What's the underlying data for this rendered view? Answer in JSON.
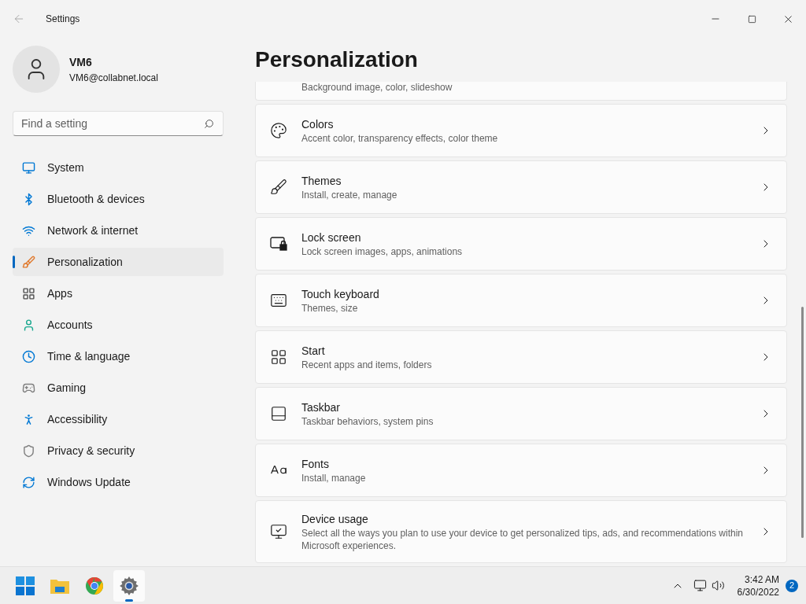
{
  "window": {
    "title": "Settings"
  },
  "profile": {
    "name": "VM6",
    "email": "VM6@collabnet.local"
  },
  "search": {
    "placeholder": "Find a setting"
  },
  "nav": [
    {
      "label": "System",
      "selected": false
    },
    {
      "label": "Bluetooth & devices",
      "selected": false
    },
    {
      "label": "Network & internet",
      "selected": false
    },
    {
      "label": "Personalization",
      "selected": true
    },
    {
      "label": "Apps",
      "selected": false
    },
    {
      "label": "Accounts",
      "selected": false
    },
    {
      "label": "Time & language",
      "selected": false
    },
    {
      "label": "Gaming",
      "selected": false
    },
    {
      "label": "Accessibility",
      "selected": false
    },
    {
      "label": "Privacy & security",
      "selected": false
    },
    {
      "label": "Windows Update",
      "selected": false
    }
  ],
  "page": {
    "title": "Personalization"
  },
  "cards": [
    {
      "kind": "partial",
      "subtitle": "Background image, color, slideshow"
    },
    {
      "kind": "full",
      "title": "Colors",
      "subtitle": "Accent color, transparency effects, color theme"
    },
    {
      "kind": "full",
      "title": "Themes",
      "subtitle": "Install, create, manage"
    },
    {
      "kind": "full",
      "title": "Lock screen",
      "subtitle": "Lock screen images, apps, animations"
    },
    {
      "kind": "full",
      "title": "Touch keyboard",
      "subtitle": "Themes, size"
    },
    {
      "kind": "full",
      "title": "Start",
      "subtitle": "Recent apps and items, folders"
    },
    {
      "kind": "full",
      "title": "Taskbar",
      "subtitle": "Taskbar behaviors, system pins"
    },
    {
      "kind": "full",
      "title": "Fonts",
      "subtitle": "Install, manage"
    },
    {
      "kind": "full",
      "title": "Device usage",
      "subtitle": "Select all the ways you plan to use your device to get personalized tips, ads, and recommendations within Microsoft experiences."
    }
  ],
  "taskbar": {
    "apps": [
      {
        "selected": false
      },
      {
        "selected": false
      },
      {
        "selected": false
      },
      {
        "selected": true
      }
    ],
    "time": "3:42 AM",
    "date": "6/30/2022",
    "notifications": "2"
  }
}
